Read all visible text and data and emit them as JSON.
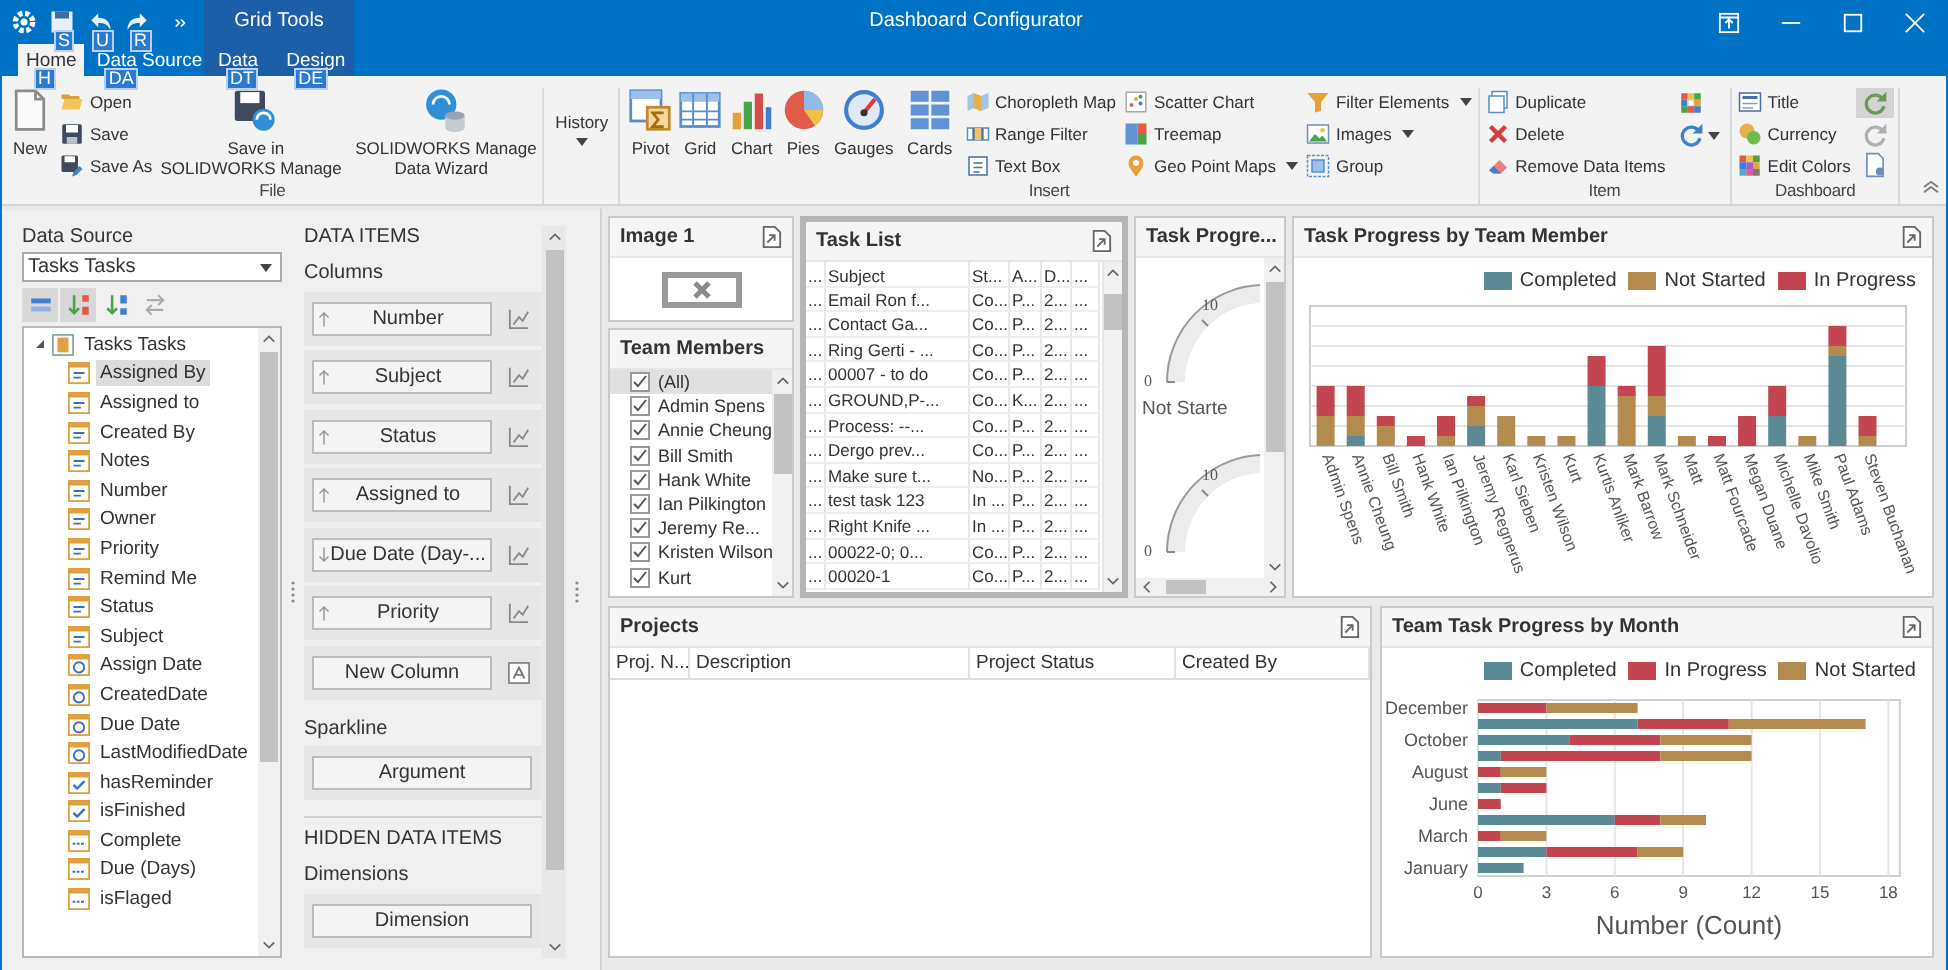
{
  "window": {
    "title": "Dashboard Configurator",
    "context_group": "Grid Tools"
  },
  "quick_access": [
    {
      "keytip": "S"
    },
    {
      "keytip": "U"
    },
    {
      "keytip": "R"
    }
  ],
  "tabs": [
    {
      "label": "Home",
      "keytip": "H",
      "selected": true,
      "contextual": false
    },
    {
      "label": "Data Source",
      "keytip": "DA",
      "selected": false,
      "contextual": false
    },
    {
      "label": "Data",
      "keytip": "DT",
      "selected": false,
      "contextual": true
    },
    {
      "label": "Design",
      "keytip": "DE",
      "selected": false,
      "contextual": true
    }
  ],
  "ribbon_groups": [
    {
      "label": "File",
      "columns": [
        {
          "kind": "large",
          "buttons": [
            {
              "label": "New"
            }
          ]
        },
        {
          "kind": "small",
          "buttons": [
            {
              "label": "Open"
            },
            {
              "label": "Save"
            },
            {
              "label": "Save As"
            }
          ]
        },
        {
          "kind": "large",
          "buttons": [
            {
              "label": "Save in\nSOLIDWORKS Manage"
            },
            {
              "label": "SOLIDWORKS Manage\nData Wizard"
            }
          ]
        }
      ]
    },
    {
      "columns": [
        {
          "kind": "large",
          "buttons": [
            {
              "label": "History",
              "dropdown": true
            }
          ]
        }
      ]
    },
    {
      "label": "Insert",
      "columns": [
        {
          "kind": "large",
          "buttons": [
            {
              "label": "Pivot"
            },
            {
              "label": "Grid"
            },
            {
              "label": "Chart"
            },
            {
              "label": "Pies"
            },
            {
              "label": "Gauges"
            },
            {
              "label": "Cards"
            }
          ]
        },
        {
          "kind": "small",
          "buttons": [
            {
              "label": "Choropleth Map"
            },
            {
              "label": "Range Filter"
            },
            {
              "label": "Text Box"
            }
          ]
        },
        {
          "kind": "small",
          "buttons": [
            {
              "label": "Scatter Chart"
            },
            {
              "label": "Treemap"
            },
            {
              "label": "Geo Point Maps",
              "dropdown": true
            }
          ]
        },
        {
          "kind": "small",
          "buttons": [
            {
              "label": "Filter Elements",
              "dropdown": true
            },
            {
              "label": "Images",
              "dropdown": true
            },
            {
              "label": "Group"
            }
          ]
        }
      ]
    },
    {
      "label": "Item",
      "columns": [
        {
          "kind": "small",
          "buttons": [
            {
              "label": "Duplicate"
            },
            {
              "label": "Delete"
            },
            {
              "label": "Remove Data Items"
            }
          ]
        },
        {
          "kind": "icons",
          "buttons": [
            {
              "dropdown": false
            },
            {
              "dropdown": true
            }
          ]
        }
      ]
    },
    {
      "label": "Dashboard",
      "columns": [
        {
          "kind": "small",
          "buttons": [
            {
              "label": "Title"
            },
            {
              "label": "Currency"
            },
            {
              "label": "Edit Colors"
            }
          ]
        },
        {
          "kind": "icons",
          "buttons": [
            {
              "checked": true
            },
            {
              "checked": false
            },
            {
              "checked": false
            }
          ]
        }
      ]
    }
  ],
  "data_source": {
    "label": "Data Source",
    "value": "Tasks Tasks",
    "toolbar": [
      {
        "checked": true
      },
      {
        "checked": true
      },
      {
        "checked": false
      },
      {
        "checked": false
      }
    ],
    "tree": [
      {
        "label": "Tasks Tasks",
        "expanded": true,
        "children": [
          {
            "label": "Assigned By",
            "kind": "text",
            "selected": true
          },
          {
            "label": "Assigned to",
            "kind": "text",
            "selected": false
          },
          {
            "label": "Created By",
            "kind": "text",
            "selected": false
          },
          {
            "label": "Notes",
            "kind": "text",
            "selected": false
          },
          {
            "label": "Number",
            "kind": "text",
            "selected": false
          },
          {
            "label": "Owner",
            "kind": "text",
            "selected": false
          },
          {
            "label": "Priority",
            "kind": "text",
            "selected": false
          },
          {
            "label": "Remind Me",
            "kind": "text",
            "selected": false
          },
          {
            "label": "Status",
            "kind": "text",
            "selected": false
          },
          {
            "label": "Subject",
            "kind": "text",
            "selected": false
          },
          {
            "label": "Assign Date",
            "kind": "date",
            "selected": false
          },
          {
            "label": "CreatedDate",
            "kind": "date",
            "selected": false
          },
          {
            "label": "Due Date",
            "kind": "date",
            "selected": false
          },
          {
            "label": "LastModifiedDate",
            "kind": "date",
            "selected": false
          },
          {
            "label": "hasReminder",
            "kind": "boolean",
            "selected": false
          },
          {
            "label": "isFinished",
            "kind": "boolean",
            "selected": false
          },
          {
            "label": "Complete",
            "kind": "number",
            "selected": false
          },
          {
            "label": "Due (Days)",
            "kind": "number",
            "selected": false
          },
          {
            "label": "isFlaged",
            "kind": "number",
            "selected": false
          }
        ]
      }
    ]
  },
  "data_items": {
    "heading": "DATA ITEMS",
    "columns_label": "Columns",
    "columns": [
      {
        "label": "Number",
        "descending": false
      },
      {
        "label": "Subject",
        "descending": false
      },
      {
        "label": "Status",
        "descending": false
      },
      {
        "label": "Assigned to",
        "descending": false
      },
      {
        "label": "Due Date (Day-...",
        "descending": true
      },
      {
        "label": "Priority",
        "descending": false
      }
    ],
    "new_column": "New Column",
    "sparkline_label": "Sparkline",
    "sparkline_button": "Argument",
    "hidden_heading": "HIDDEN DATA ITEMS",
    "dimensions_label": "Dimensions",
    "dimension_button": "Dimension"
  },
  "image_item": {
    "title": "Image 1",
    "selected": false
  },
  "team_members": {
    "title": "Team Members",
    "selected": false,
    "items": [
      {
        "label": "(All)",
        "checked": true,
        "selected": true
      },
      {
        "label": "Admin Spens",
        "checked": true,
        "selected": false
      },
      {
        "label": "Annie Cheung",
        "checked": true,
        "selected": false
      },
      {
        "label": "Bill Smith",
        "checked": true,
        "selected": false
      },
      {
        "label": "Hank White",
        "checked": true,
        "selected": false
      },
      {
        "label": "Ian Pilkington",
        "checked": true,
        "selected": false
      },
      {
        "label": "Jeremy Re...",
        "checked": true,
        "selected": false
      },
      {
        "label": "Kristen Wilson",
        "checked": true,
        "selected": false
      },
      {
        "label": "Kurt",
        "checked": true,
        "selected": false
      }
    ]
  },
  "task_list": {
    "title": "Task List",
    "selected": true,
    "columns": [
      "...",
      "Subject",
      "St...",
      "A...",
      "D...",
      "..."
    ],
    "rows": [
      [
        "...",
        "Email Ron f...",
        "Co...",
        "P...",
        "2...",
        "..."
      ],
      [
        "...",
        "Contact Ga...",
        "Co...",
        "P...",
        "2...",
        "..."
      ],
      [
        "...",
        "Ring Gerti - ...",
        "Co...",
        "P...",
        "2...",
        "..."
      ],
      [
        "...",
        "00007 - to do",
        "Co...",
        "P...",
        "2...",
        "..."
      ],
      [
        "...",
        "GROUND,P-...",
        "Co...",
        "K...",
        "2...",
        "..."
      ],
      [
        "...",
        "Process: --...",
        "Co...",
        "P...",
        "2...",
        "..."
      ],
      [
        "...",
        "Dergo prev...",
        "Co...",
        "P...",
        "2...",
        "..."
      ],
      [
        "...",
        "Make sure t...",
        "No...",
        "P...",
        "2...",
        "..."
      ],
      [
        "...",
        "test task 123",
        "In ...",
        "P...",
        "2...",
        "..."
      ],
      [
        "...",
        "Right Knife ...",
        "In ...",
        "P...",
        "2...",
        "..."
      ],
      [
        "...",
        "00022-0; 0...",
        "Co...",
        "P...",
        "2...",
        "..."
      ],
      [
        "...",
        "00020-1",
        "Co...",
        "P...",
        "2...",
        "..."
      ]
    ]
  },
  "gauges": {
    "title": "Task Progre...",
    "selected": false,
    "items": [
      {
        "max_label": "10",
        "min_label": "0",
        "caption": "Not Starte"
      },
      {
        "max_label": "10",
        "min_label": "0"
      }
    ]
  },
  "member_chart": {
    "title": "Task Progress by Team Member",
    "selected": false,
    "legend": [
      {
        "name": "Completed",
        "color": "#5b8a95"
      },
      {
        "name": "Not Started",
        "color": "#b38b4f"
      },
      {
        "name": "In Progress",
        "color": "#c2454f"
      }
    ],
    "categories": [
      "Admin Spens",
      "Annie Cheung",
      "Bill Smith",
      "Hank White",
      "Ian Pilkington",
      "Jeremy Regnerus",
      "Karl Sieben",
      "Kristen Wilson",
      "Kurt",
      "Kurtis Anliker",
      "Mark Barrow",
      "Mark Schneider",
      "Matt",
      "Matt Fourcade",
      "Megan Duane",
      "Michelle Davolio",
      "Mike Smith",
      "Paul Adams",
      "Steven Buchanan"
    ]
  },
  "projects": {
    "title": "Projects",
    "selected": false,
    "columns": [
      "Proj. N...",
      "Description",
      "Project Status",
      "Created By"
    ]
  },
  "month_chart": {
    "selected": false,
    "chart_data": {
      "type": "bar",
      "title": "Team Task Progress by Month",
      "orientation": "horizontal",
      "stacked": true,
      "xlabel": "Number (Count)",
      "categories": [
        "December",
        null,
        "October",
        null,
        "August",
        null,
        "June",
        null,
        "March",
        null,
        "January"
      ],
      "series": [
        {
          "name": "Completed",
          "color": "#5b8a95",
          "values": [
            0,
            7,
            4,
            1,
            0,
            1,
            0,
            6,
            0,
            3,
            2
          ]
        },
        {
          "name": "In Progress",
          "color": "#c2454f",
          "values": [
            3,
            4,
            4,
            7,
            1,
            2,
            1,
            2,
            1,
            4,
            0
          ]
        },
        {
          "name": "Not Started",
          "color": "#b38b4f",
          "values": [
            4,
            6,
            4,
            4,
            2,
            0,
            0,
            2,
            2,
            2,
            0
          ]
        }
      ],
      "xlim": [
        0,
        18.5
      ],
      "xticks": [
        0,
        3,
        6,
        9,
        12,
        15,
        18
      ],
      "legend": true,
      "grid": true
    }
  }
}
